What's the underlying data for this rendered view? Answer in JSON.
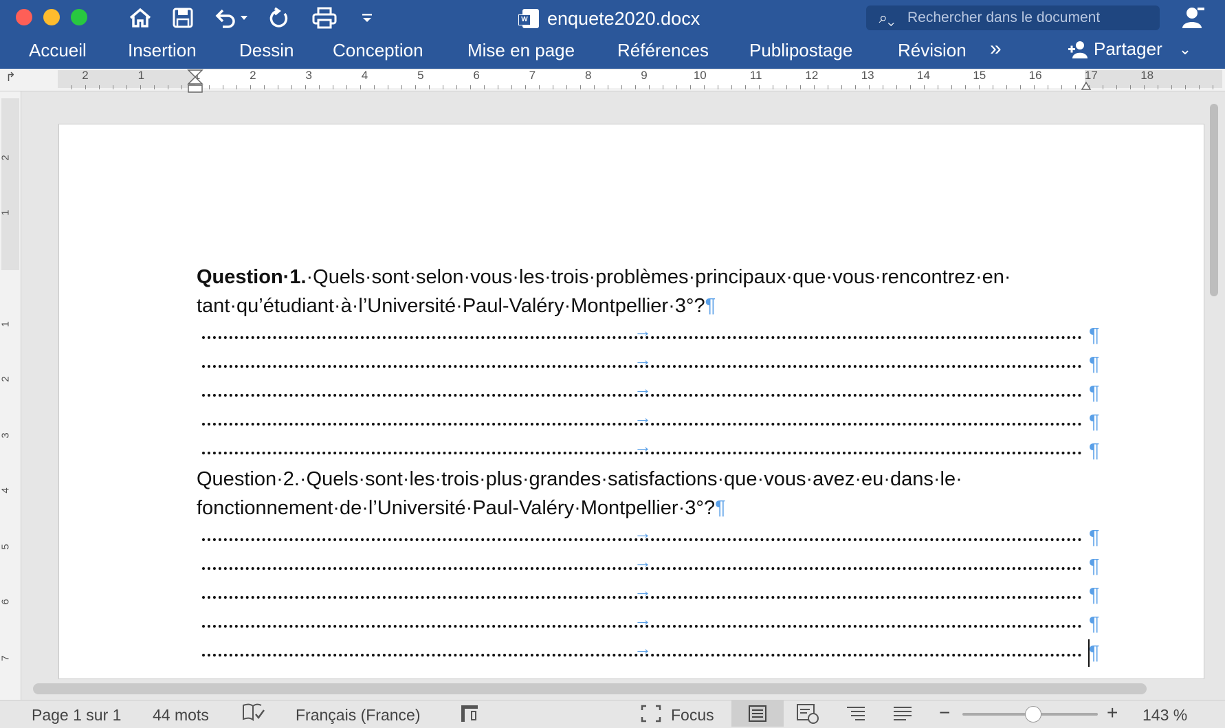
{
  "window": {
    "title": "enquete2020.docx",
    "accent": "#2b579a"
  },
  "toolbar": {
    "icons": [
      "home-icon",
      "save-icon",
      "undo-icon",
      "redo-icon",
      "print-icon",
      "customize-icon"
    ]
  },
  "search": {
    "placeholder": "Rechercher dans le document"
  },
  "tabs": [
    {
      "label": "Accueil"
    },
    {
      "label": "Insertion"
    },
    {
      "label": "Dessin"
    },
    {
      "label": "Conception"
    },
    {
      "label": "Mise en page"
    },
    {
      "label": "Références"
    },
    {
      "label": "Publipostage"
    },
    {
      "label": "Révision"
    }
  ],
  "more_tabs": "»",
  "share": {
    "label": "Partager"
  },
  "ruler": {
    "labels": [
      "2",
      "1",
      "1",
      "2",
      "3",
      "4",
      "5",
      "6",
      "7",
      "8",
      "9",
      "10",
      "11",
      "12",
      "13",
      "14",
      "15",
      "16",
      "17",
      "18"
    ]
  },
  "vruler": {
    "labels": [
      "2",
      "1",
      "1",
      "2",
      "3",
      "4",
      "5",
      "6",
      "7"
    ]
  },
  "document": {
    "q1_bold": "Question·1.",
    "q1_line1": "·Quels·sont·selon·vous·les·trois·problèmes·principaux·que·vous·rencontrez·en·",
    "q1_line2": "tant·qu’étudiant·à·l’Université·Paul-Valéry·Montpellier·3°?",
    "q2_line1": "Question·2.·Quels·sont·les·trois·plus·grandes·satisfactions·que·vous·avez·eu·dans·le·",
    "q2_line2": "fonctionnement·de·l’Université·Paul-Valéry·Montpellier·3°?",
    "pilcrow": "¶",
    "tab_arrow": "→"
  },
  "status": {
    "page": "Page 1 sur 1",
    "words": "44 mots",
    "language": "Français (France)",
    "focus": "Focus",
    "zoom": "143 %",
    "zoom_minus": "−",
    "zoom_plus": "+",
    "zoom_level": 0.52
  }
}
